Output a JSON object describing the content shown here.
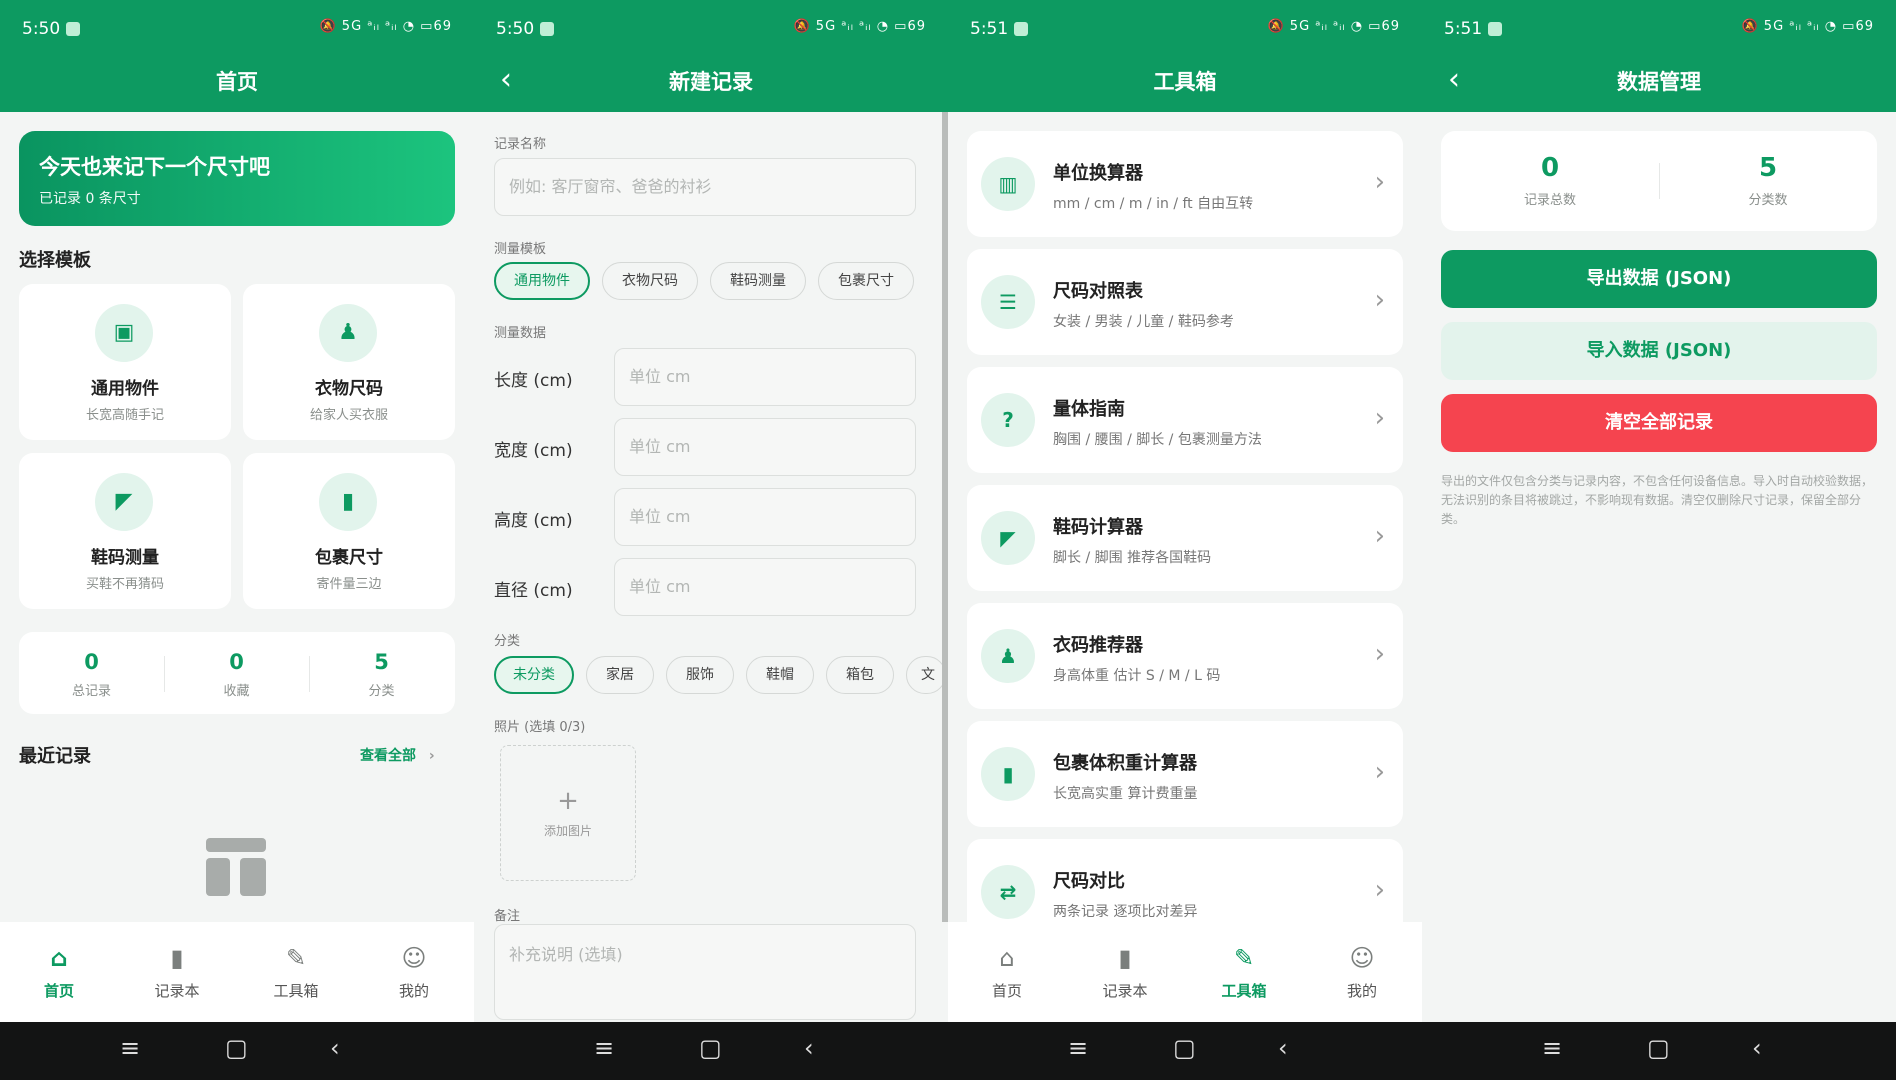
{
  "status": {
    "icons": "🔕 5G ᵃᵢₗ ᵃᵢₗ ◔ ▭69",
    "battery": "69"
  },
  "s1": {
    "time": "5:50",
    "title": "首页",
    "hero_title": "今天也来记下一个尺寸吧",
    "hero_sub": "已记录 0 条尺寸",
    "choose_title": "选择模板",
    "templates": [
      {
        "icon": "▣",
        "title": "通用物件",
        "desc": "长宽高随手记"
      },
      {
        "icon": "♟",
        "title": "衣物尺码",
        "desc": "给家人买衣服"
      },
      {
        "icon": "◤",
        "title": "鞋码测量",
        "desc": "买鞋不再猜码"
      },
      {
        "icon": "▮",
        "title": "包裹尺寸",
        "desc": "寄件量三边"
      }
    ],
    "stats": [
      {
        "value": "0",
        "label": "总记录"
      },
      {
        "value": "0",
        "label": "收藏"
      },
      {
        "value": "5",
        "label": "分类"
      }
    ],
    "recent_title": "最近记录",
    "view_all": "查看全部"
  },
  "s2": {
    "time": "5:50",
    "title": "新建记录",
    "name_label": "记录名称",
    "name_placeholder": "例如: 客厅窗帘、爸爸的衬衫",
    "template_label": "测量模板",
    "template_chips": [
      "通用物件",
      "衣物尺码",
      "鞋码测量",
      "包裹尺寸"
    ],
    "data_label": "测量数据",
    "fields": [
      {
        "label": "长度 (cm)",
        "placeholder": "单位 cm"
      },
      {
        "label": "宽度 (cm)",
        "placeholder": "单位 cm"
      },
      {
        "label": "高度 (cm)",
        "placeholder": "单位 cm"
      },
      {
        "label": "直径 (cm)",
        "placeholder": "单位 cm"
      }
    ],
    "category_label": "分类",
    "category_chips": [
      "未分类",
      "家居",
      "服饰",
      "鞋帽",
      "箱包",
      "文"
    ],
    "photo_label": "照片 (选填 0/3)",
    "add_photo": "添加图片",
    "remark_label": "备注",
    "remark_placeholder": "补充说明 (选填)"
  },
  "s3": {
    "time": "5:51",
    "title": "工具箱",
    "tools": [
      {
        "icon": "▥",
        "title": "单位换算器",
        "desc": "mm / cm / m / in / ft 自由互转"
      },
      {
        "icon": "☰",
        "title": "尺码对照表",
        "desc": "女装 / 男装 / 儿童 / 鞋码参考"
      },
      {
        "icon": "?",
        "title": "量体指南",
        "desc": "胸围 / 腰围 / 脚长 / 包裹测量方法"
      },
      {
        "icon": "◤",
        "title": "鞋码计算器",
        "desc": "脚长 / 脚围 推荐各国鞋码"
      },
      {
        "icon": "♟",
        "title": "衣码推荐器",
        "desc": "身高体重 估计 S / M / L 码"
      },
      {
        "icon": "▮",
        "title": "包裹体积重计算器",
        "desc": "长宽高实重 算计费重量"
      },
      {
        "icon": "⇄",
        "title": "尺码对比",
        "desc": "两条记录 逐项比对差异"
      }
    ]
  },
  "s4": {
    "time": "5:51",
    "title": "数据管理",
    "stats": [
      {
        "value": "0",
        "label": "记录总数"
      },
      {
        "value": "5",
        "label": "分类数"
      }
    ],
    "export": "导出数据 (JSON)",
    "import": "导入数据 (JSON)",
    "clear": "清空全部记录",
    "note": "导出的文件仅包含分类与记录内容，不包含任何设备信息。导入时自动校验数据，无法识别的条目将被跳过，不影响现有数据。清空仅删除尺寸记录，保留全部分类。"
  },
  "tabs": [
    {
      "icon": "⌂",
      "label": "首页"
    },
    {
      "icon": "▮",
      "label": "记录本"
    },
    {
      "icon": "✎",
      "label": "工具箱"
    },
    {
      "icon": "☺",
      "label": "我的"
    }
  ],
  "nav": {
    "menu": "≡",
    "home": "▢",
    "back": "‹"
  },
  "colors": {
    "primary": "#0d9a61",
    "danger": "#f5444f",
    "light": "#e3f3ec"
  }
}
